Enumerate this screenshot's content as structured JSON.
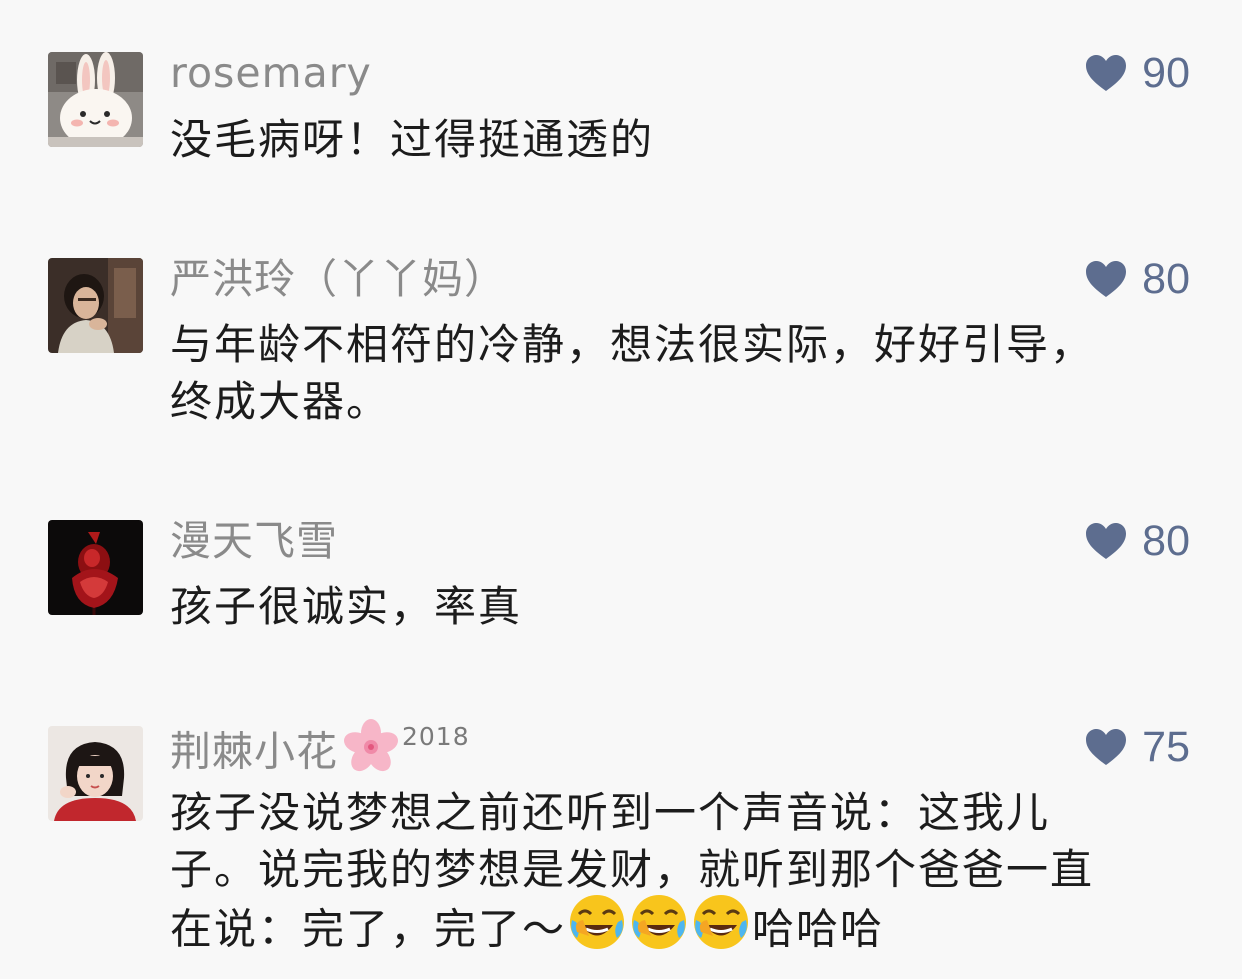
{
  "comments": [
    {
      "username": "rosemary",
      "likes": "90",
      "text": "没毛病呀！过得挺通透的",
      "avatar": "bunny-avatar"
    },
    {
      "username": "严洪玲（丫丫妈）",
      "likes": "80",
      "text_lines": [
        "与年龄不相符的冷静，想法很实际，好好引导，",
        "终成大器。"
      ],
      "avatar": "woman-portrait-avatar"
    },
    {
      "username": "漫天飞雪",
      "likes": "80",
      "text": "孩子很诚实，率真",
      "avatar": "red-rose-avatar"
    },
    {
      "username": "荆棘小花",
      "badge": "2018",
      "likes": "75",
      "text_lines": [
        "孩子没说梦想之前还听到一个声音说：这我儿",
        "子。说完我的梦想是发财，就听到那个爸爸一直"
      ],
      "text_last_prefix": "在说：完了，完了～",
      "text_last_suffix": "哈哈哈",
      "emoji": "laughing-crying-emoji",
      "avatar": "girl-portrait-avatar"
    }
  ],
  "colors": {
    "background": "#f8f8f8",
    "username": "#8a8a8a",
    "like": "#5d6d8f",
    "text": "#1c1c1c"
  },
  "icons": {
    "like": "heart-icon",
    "badge_flower": "cherry-blossom-icon"
  }
}
